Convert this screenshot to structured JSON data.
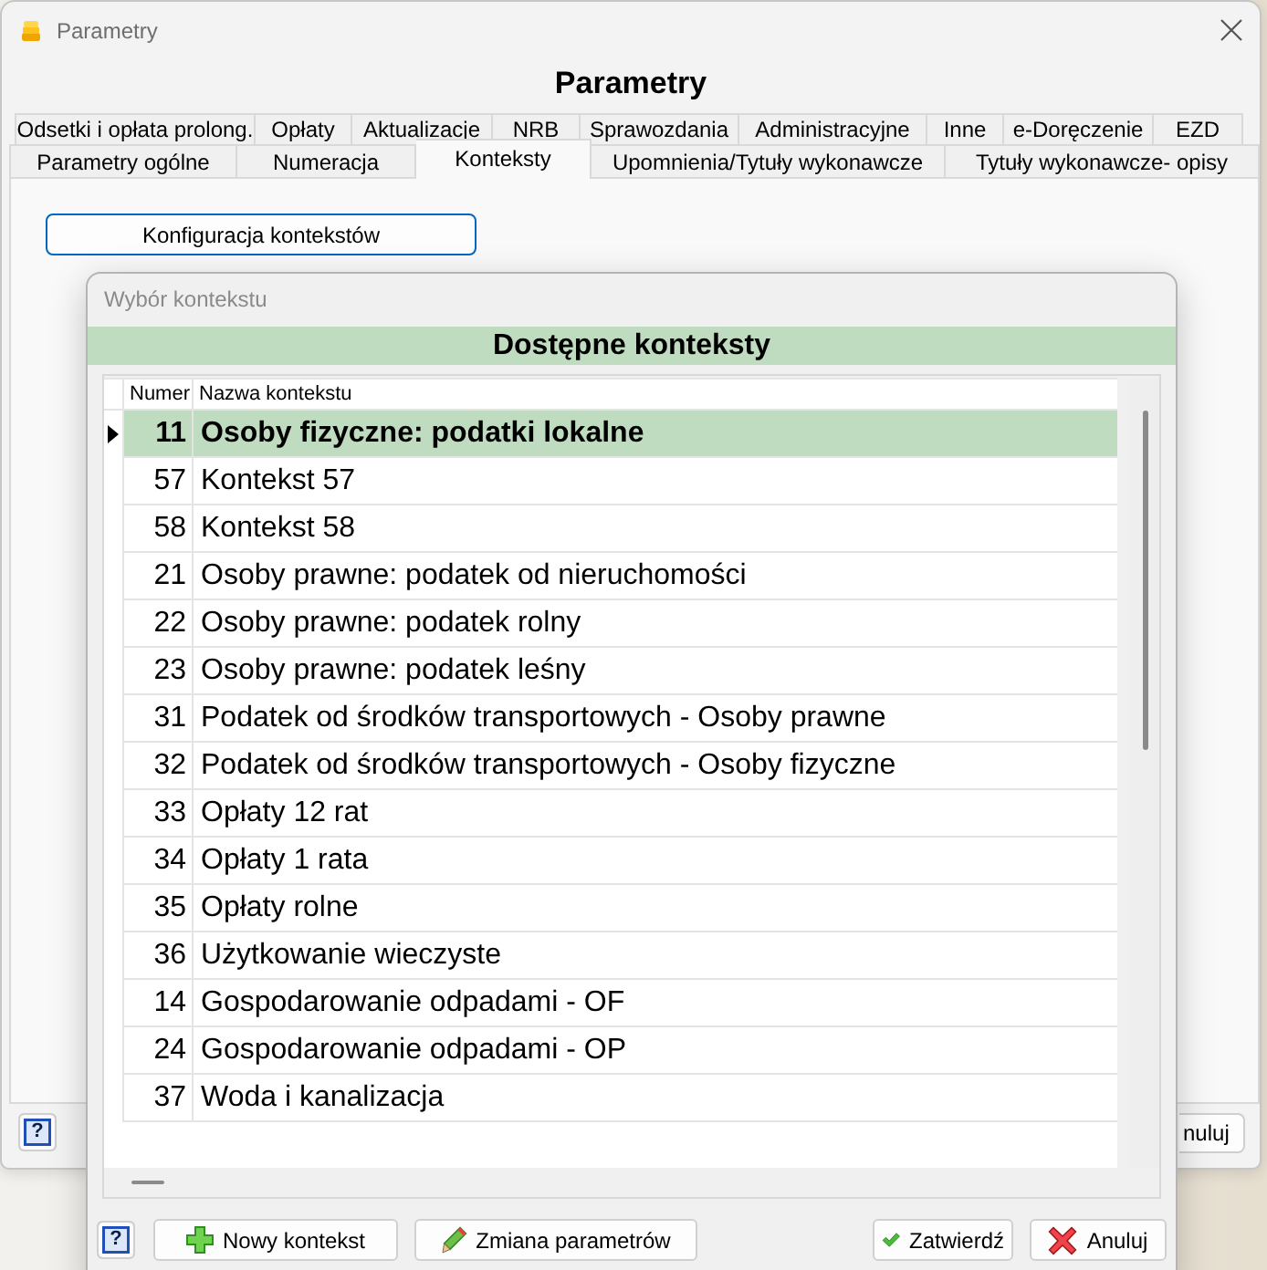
{
  "window": {
    "title": "Parametry",
    "heading": "Parametry"
  },
  "tab_rows": [
    [
      {
        "label": "Odsetki i opłata prolong.",
        "selected": false
      },
      {
        "label": "Opłaty",
        "selected": false
      },
      {
        "label": "Aktualizacje",
        "selected": false
      },
      {
        "label": "NRB",
        "selected": false
      },
      {
        "label": "Sprawozdania",
        "selected": false
      },
      {
        "label": "Administracyjne",
        "selected": false
      },
      {
        "label": "Inne",
        "selected": false
      },
      {
        "label": "e-Doręczenie",
        "selected": false
      },
      {
        "label": "EZD",
        "selected": false
      }
    ],
    [
      {
        "label": "Parametry ogólne",
        "selected": false
      },
      {
        "label": "Numeracja",
        "selected": false
      },
      {
        "label": "Konteksty",
        "selected": true
      },
      {
        "label": "Upomnienia/Tytuły wykonawcze",
        "selected": false
      },
      {
        "label": "Tytuły wykonawcze- opisy",
        "selected": false
      }
    ]
  ],
  "config_button": "Konfiguracja kontekstów",
  "footer": {
    "help": "?",
    "cancel": "nuluj"
  },
  "dialog": {
    "title": "Wybór kontekstu",
    "heading": "Dostępne konteksty",
    "columns": [
      "Numer",
      "Nazwa kontekstu"
    ],
    "rows": [
      {
        "number": "11",
        "name": "Osoby fizyczne: podatki lokalne",
        "selected": true
      },
      {
        "number": "57",
        "name": "Kontekst 57",
        "selected": false
      },
      {
        "number": "58",
        "name": "Kontekst 58",
        "selected": false
      },
      {
        "number": "21",
        "name": "Osoby prawne: podatek od nieruchomości",
        "selected": false
      },
      {
        "number": "22",
        "name": "Osoby prawne: podatek rolny",
        "selected": false
      },
      {
        "number": "23",
        "name": "Osoby prawne: podatek leśny",
        "selected": false
      },
      {
        "number": "31",
        "name": "Podatek od środków transportowych - Osoby prawne",
        "selected": false
      },
      {
        "number": "32",
        "name": "Podatek od środków transportowych - Osoby fizyczne",
        "selected": false
      },
      {
        "number": "33",
        "name": "Opłaty 12 rat",
        "selected": false
      },
      {
        "number": "34",
        "name": "Opłaty 1 rata",
        "selected": false
      },
      {
        "number": "35",
        "name": "Opłaty rolne",
        "selected": false
      },
      {
        "number": "36",
        "name": "Użytkowanie wieczyste",
        "selected": false
      },
      {
        "number": "14",
        "name": "Gospodarowanie odpadami - OF",
        "selected": false
      },
      {
        "number": "24",
        "name": "Gospodarowanie odpadami - OP",
        "selected": false
      },
      {
        "number": "37",
        "name": "Woda i kanalizacja",
        "selected": false
      }
    ],
    "buttons": [
      {
        "kind": "help",
        "label": "?"
      },
      {
        "kind": "add",
        "label": "Nowy kontekst"
      },
      {
        "kind": "edit",
        "label": "Zmiana parametrów"
      },
      {
        "kind": "confirm",
        "label": "Zatwierdź"
      },
      {
        "kind": "cancel",
        "label": "Anuluj"
      }
    ]
  }
}
